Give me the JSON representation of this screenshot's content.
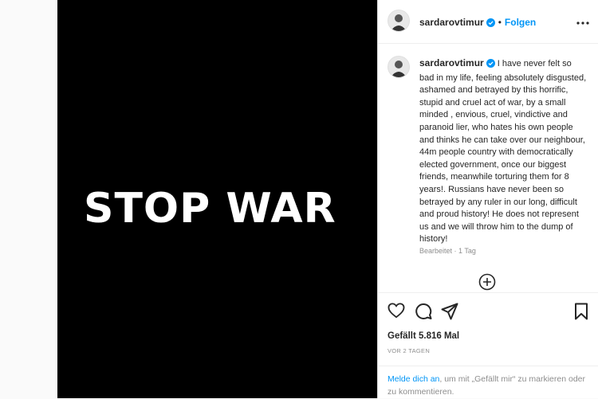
{
  "post": {
    "media_text": "STOP WAR",
    "username": "sardarovtimur",
    "follow_label": "Folgen",
    "separator": "•",
    "caption": "I have never felt so bad in my life, feeling absolutely disgusted, ashamed and betrayed by this horrific, stupid and cruel act of war, by a small minded , envious, cruel, vindictive and paranoid lier, who hates his own people and thinks he can take over our neighbour, 44m people country with democratically elected government, once our biggest friends, meanwhile torturing them for 8 years!. Russians have never been so betrayed by any ruler in our long, difficult and proud history! He does not represent us and we will throw him to the dump of history!",
    "edited": "Bearbeitet · 1 Tag",
    "likes": "Gefällt 5.816 Mal",
    "time_ago": "VOR 2 TAGEN",
    "login_link": "Melde dich an",
    "login_rest": ", um mit „Gefällt mir“ zu markieren oder zu kommentieren."
  },
  "icons": {
    "verified": "verified-badge-icon",
    "more": "more-options-icon",
    "add": "add-circle-icon",
    "like": "heart-icon",
    "comment": "comment-icon",
    "share": "share-icon",
    "save": "bookmark-icon"
  },
  "colors": {
    "accent": "#0095f6",
    "text": "#262626",
    "muted": "#8e8e8e"
  }
}
